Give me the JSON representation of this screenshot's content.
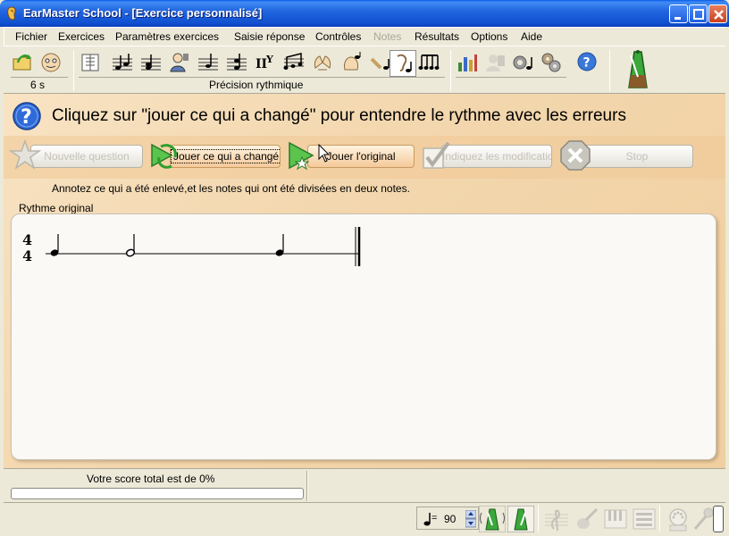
{
  "window": {
    "title": "EarMaster School - [Exercice personnalisé]"
  },
  "menu": {
    "items": [
      {
        "label": "Fichier",
        "enabled": true
      },
      {
        "label": "Exercices",
        "enabled": true
      },
      {
        "label": "Paramètres exercices",
        "enabled": true
      },
      {
        "label": "Saisie réponse",
        "enabled": true
      },
      {
        "label": "Contrôles",
        "enabled": true
      },
      {
        "label": "Notes",
        "enabled": false
      },
      {
        "label": "Résultats",
        "enabled": true
      },
      {
        "label": "Options",
        "enabled": true
      },
      {
        "label": "Aide",
        "enabled": true
      }
    ]
  },
  "toolbar": {
    "time_label": "6 s",
    "mode_label": "Précision rythmique"
  },
  "main": {
    "prompt": "Cliquez sur \"jouer ce qui a changé\" pour entendre le rythme avec les erreurs",
    "buttons": {
      "new_question": "Nouvelle question",
      "play_changed": "Jouer ce qui a changé",
      "play_original": "Jouer l'original",
      "show_changes": "Indiquez les modifications",
      "stop": "Stop"
    },
    "instruction": "Annotez ce qui a été enlevé,et les notes qui ont été divisées en deux notes.",
    "section_label": "Rythme original",
    "staff": {
      "time_signature_top": "4",
      "time_signature_bottom": "4"
    }
  },
  "status": {
    "score_text": "Votre score total est de 0%",
    "score_percent": 0
  },
  "bottom": {
    "tempo_value": "90",
    "tempo_equals": "="
  },
  "colors": {
    "titlebar": "#0A5BEB",
    "panel_bg": "#F3D7AE",
    "score_fill": "#5BC44D"
  }
}
